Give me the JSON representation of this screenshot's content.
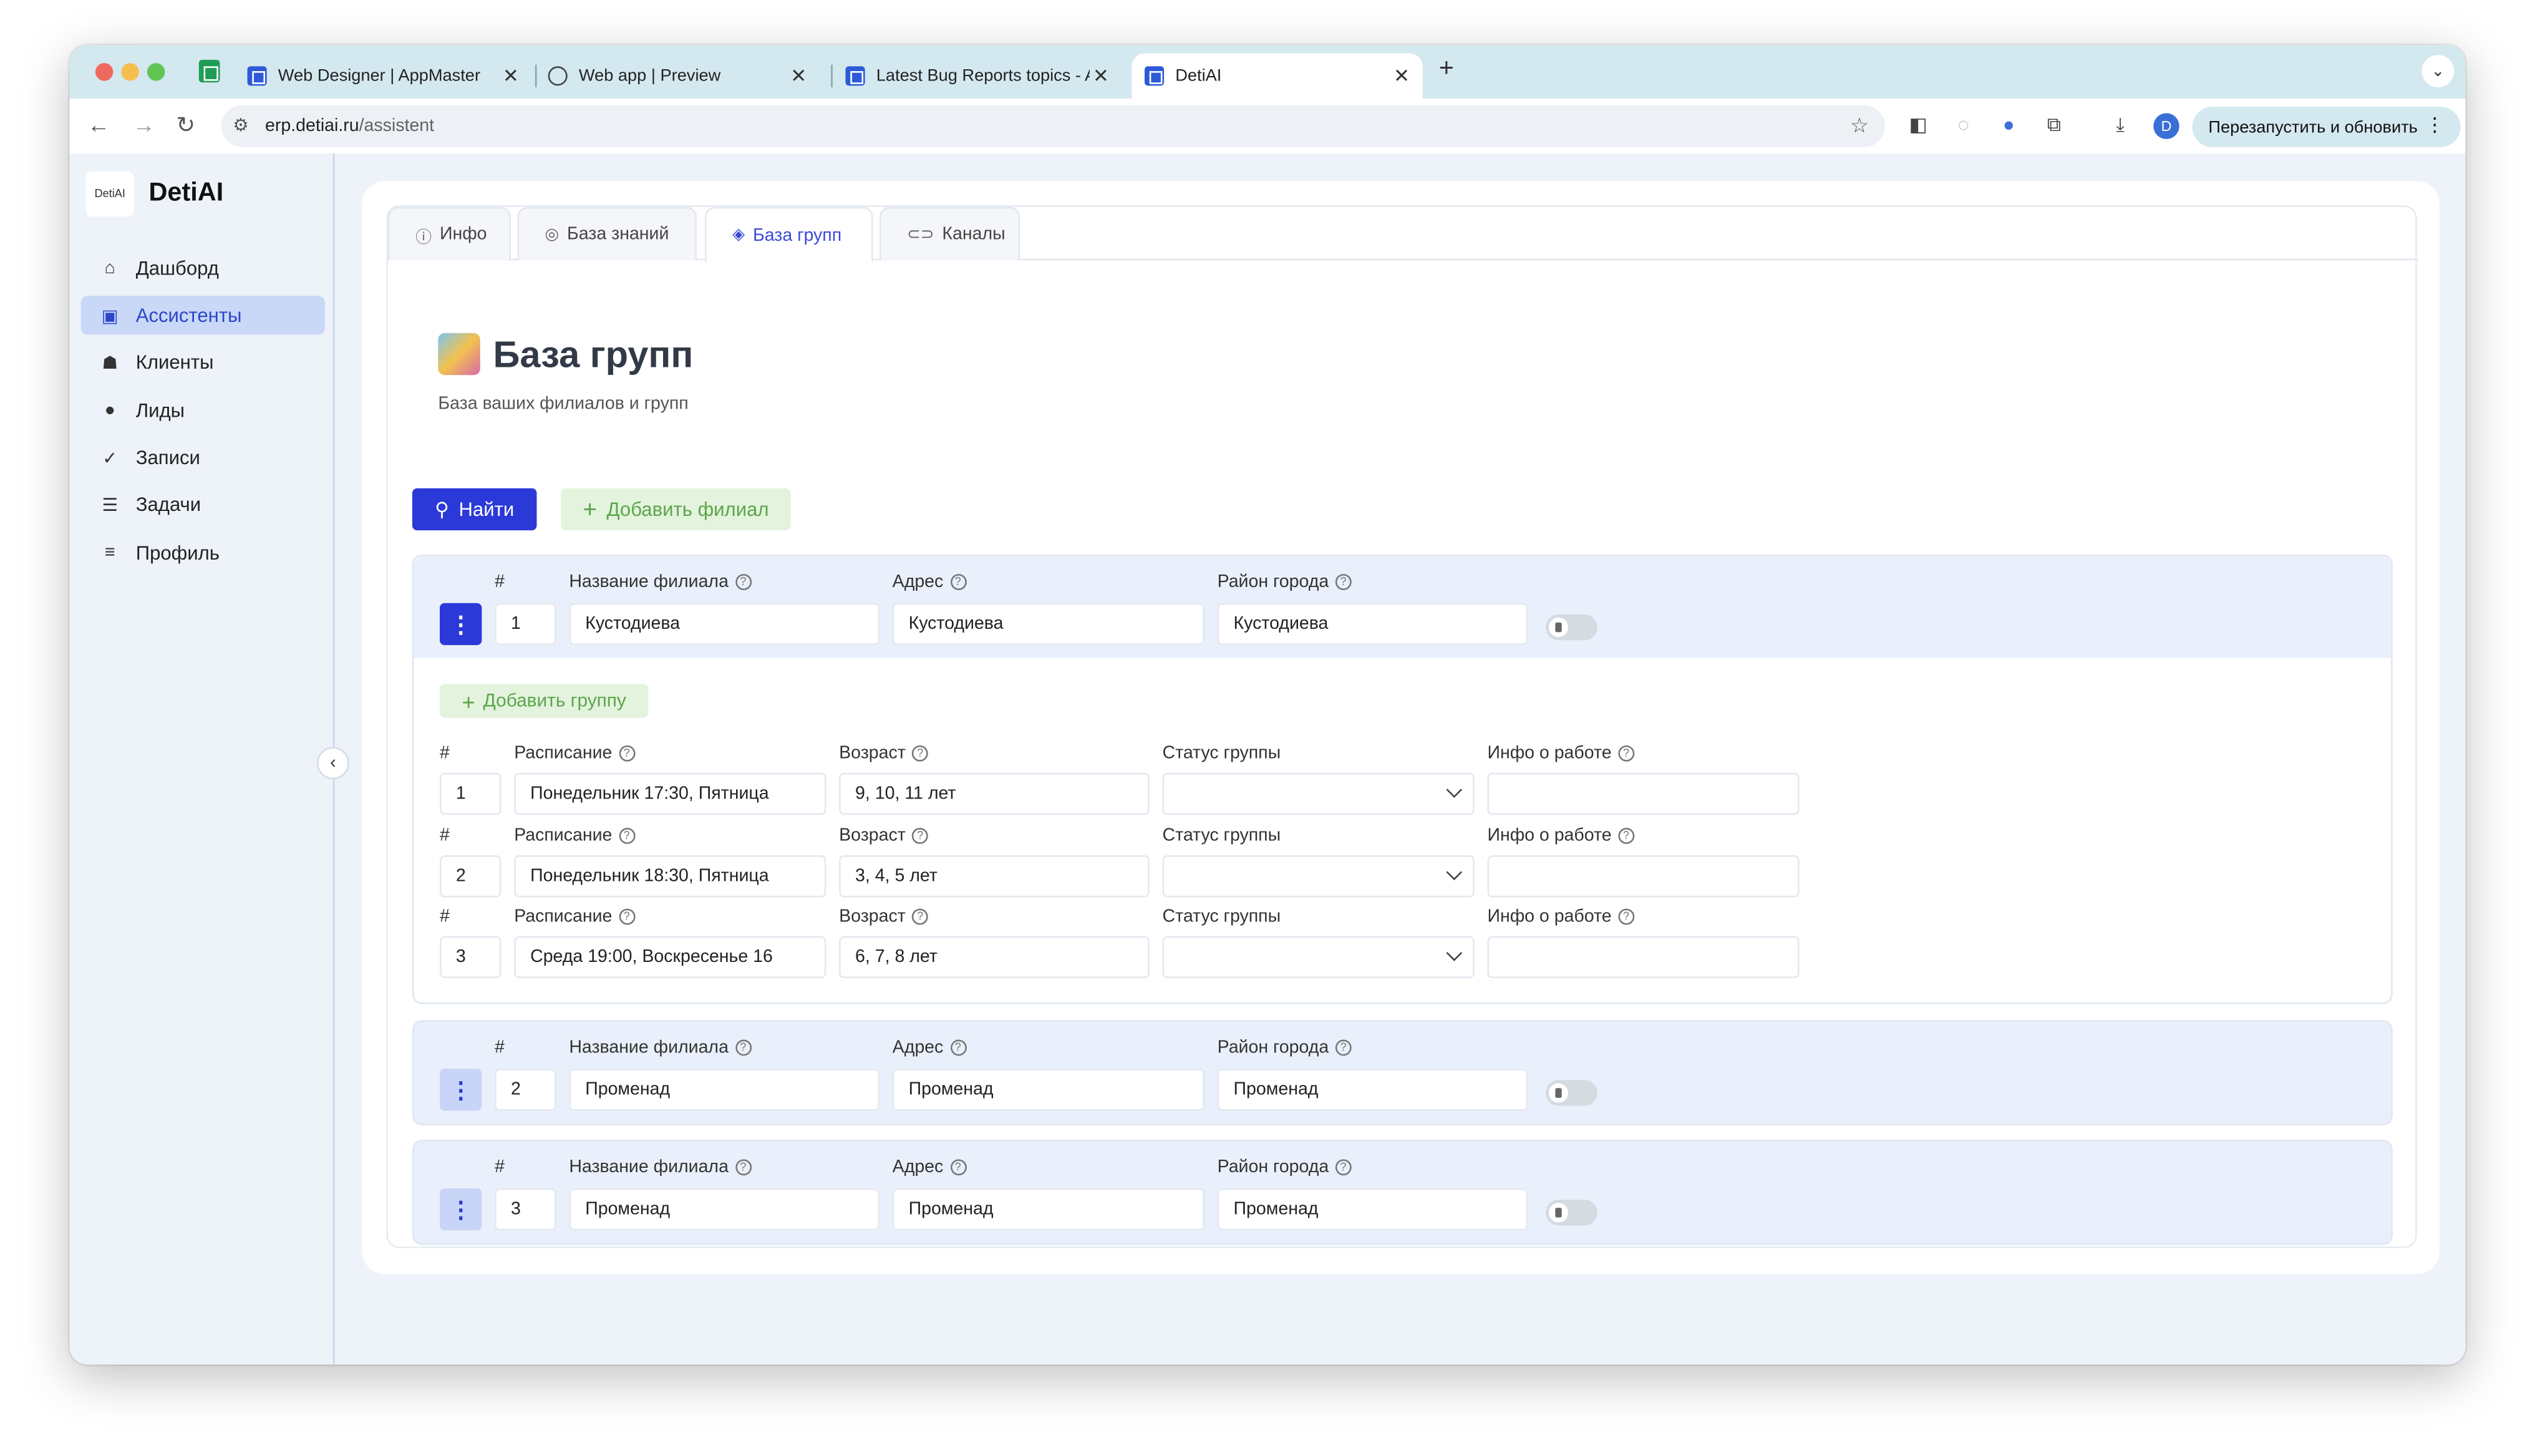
{
  "browser": {
    "tabs": [
      {
        "label": "Web Designer | AppMaster"
      },
      {
        "label": "Web app | Preview"
      },
      {
        "label": "Latest Bug Reports topics - A"
      },
      {
        "label": "DetiAI"
      }
    ],
    "url_domain": "erp.detiai.ru",
    "url_path": "/assistent",
    "avatar_letter": "D",
    "relaunch_label": "Перезапустить и обновить"
  },
  "sidebar": {
    "logo_text": "DetiAI",
    "brand": "DetiAI",
    "items": [
      {
        "label": "Дашборд",
        "icon": "home-icon"
      },
      {
        "label": "Ассистенты",
        "icon": "assistant-icon",
        "active": true
      },
      {
        "label": "Клиенты",
        "icon": "users-icon"
      },
      {
        "label": "Лиды",
        "icon": "user-icon"
      },
      {
        "label": "Записи",
        "icon": "check-icon"
      },
      {
        "label": "Задачи",
        "icon": "list-icon"
      },
      {
        "label": "Профиль",
        "icon": "sliders-icon"
      }
    ]
  },
  "page_tabs": [
    {
      "label": "Инфо"
    },
    {
      "label": "База знаний"
    },
    {
      "label": "База групп",
      "active": true
    },
    {
      "label": "Каналы"
    }
  ],
  "header": {
    "title": "База групп",
    "subtitle": "База ваших филиалов и групп"
  },
  "actions": {
    "find_label": "Найти",
    "add_branch_label": "Добавить филиал",
    "add_group_label": "Добавить группу"
  },
  "labels": {
    "num": "#",
    "branch_name": "Название филиала",
    "address": "Адрес",
    "district": "Район города",
    "schedule": "Расписание",
    "age": "Возраст",
    "group_status": "Статус группы",
    "work_info": "Инфо о работе"
  },
  "branches": [
    {
      "num": "1",
      "name": "Кустодиева",
      "address": "Кустодиева",
      "district": "Кустодиева",
      "groups": [
        {
          "num": "1",
          "schedule": "Понедельник 17:30, Пятница",
          "age": "9, 10, 11 лет",
          "status": "",
          "info": ""
        },
        {
          "num": "2",
          "schedule": "Понедельник 18:30, Пятница",
          "age": "3, 4, 5 лет",
          "status": "",
          "info": ""
        },
        {
          "num": "3",
          "schedule": "Среда 19:00, Воскресенье 16",
          "age": "6, 7, 8 лет",
          "status": "",
          "info": ""
        }
      ]
    },
    {
      "num": "2",
      "name": "Променад",
      "address": "Променад",
      "district": "Променад"
    },
    {
      "num": "3",
      "name": "Променад",
      "address": "Променад",
      "district": "Променад"
    }
  ],
  "colors": {
    "accent": "#2b39d8",
    "success_bg": "#e3f3dd",
    "success_text": "#5ba64b",
    "sidebar_active": "#c9d8f7"
  }
}
